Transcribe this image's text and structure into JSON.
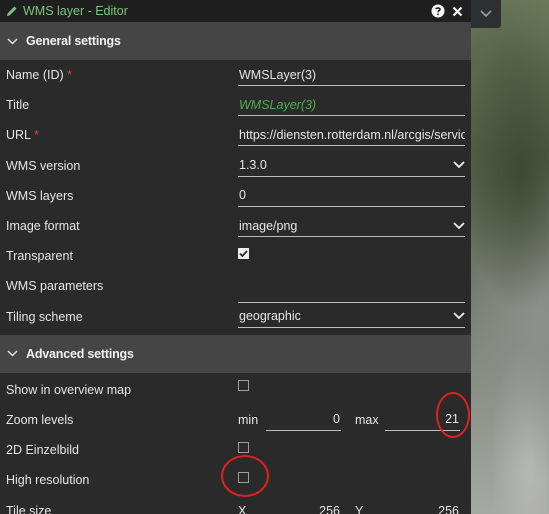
{
  "window": {
    "title": "WMS layer - Editor",
    "help_icon": "help-circle-icon",
    "close_icon": "close-icon"
  },
  "general": {
    "header": "General settings",
    "name_label": "Name (ID)",
    "name_required": "*",
    "name_value": "WMSLayer(3)",
    "title_label": "Title",
    "title_placeholder": "WMSLayer(3)",
    "url_label": "URL",
    "url_required": "*",
    "url_value": "https://diensten.rotterdam.nl/arcgis/service",
    "version_label": "WMS version",
    "version_value": "1.3.0",
    "layers_label": "WMS layers",
    "layers_value": "0",
    "format_label": "Image format",
    "format_value": "image/png",
    "transparent_label": "Transparent",
    "transparent_checked": true,
    "params_label": "WMS parameters",
    "params_value": "",
    "tiling_label": "Tiling scheme",
    "tiling_value": "geographic"
  },
  "advanced": {
    "header": "Advanced settings",
    "overview_label": "Show in overview map",
    "overview_checked": false,
    "zoom_label": "Zoom levels",
    "zoom_min_label": "min",
    "zoom_min_value": "0",
    "zoom_max_label": "max",
    "zoom_max_value": "21",
    "einzelbild_label": "2D Einzelbild",
    "einzelbild_checked": false,
    "highres_label": "High resolution",
    "highres_checked": false,
    "tilesize_label": "Tile size",
    "tile_x_label": "X",
    "tile_x_value": "256",
    "tile_y_label": "Y",
    "tile_y_value": "256"
  },
  "colors": {
    "accent_green": "#7dc47d",
    "required_red": "#d64545",
    "annotation_red": "#e02020"
  }
}
